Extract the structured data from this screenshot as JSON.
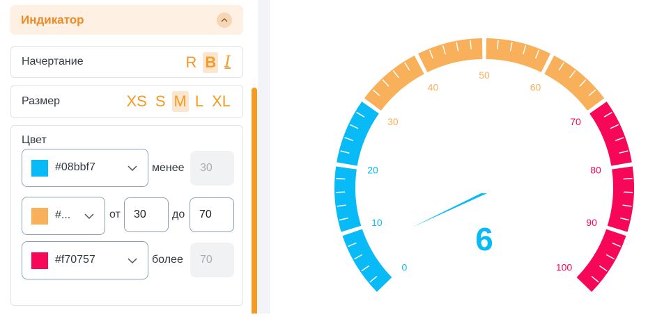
{
  "section": {
    "title": "Индикатор",
    "collapse_icon": "chevron-up-icon"
  },
  "style_card": {
    "label": "Начертание",
    "options": [
      "R",
      "B",
      "I"
    ],
    "selected": "B"
  },
  "size_card": {
    "label": "Размер",
    "options": [
      "XS",
      "S",
      "M",
      "L",
      "XL"
    ],
    "selected": "M"
  },
  "color_card": {
    "label": "Цвет",
    "low": {
      "color": "#08bbf7",
      "value": "#08bbf7",
      "cond_label": "менее",
      "threshold": "30"
    },
    "mid": {
      "color": "#f9b05a",
      "value": "#...",
      "from_label": "от",
      "from": "30",
      "to_label": "до",
      "to": "70"
    },
    "high": {
      "color": "#f70757",
      "value": "#f70757",
      "cond_label": "более",
      "threshold": "70"
    }
  },
  "gauge": {
    "value": 6,
    "value_text": "6",
    "min": 0,
    "max": 100,
    "tick_labels": [
      "0",
      "10",
      "20",
      "30",
      "40",
      "50",
      "60",
      "70",
      "80",
      "90",
      "100"
    ],
    "bands": [
      {
        "from": 0,
        "to": 30,
        "color": "#08bbf7"
      },
      {
        "from": 30,
        "to": 70,
        "color": "#f9b05a"
      },
      {
        "from": 70,
        "to": 100,
        "color": "#f70757"
      }
    ]
  },
  "colors": {
    "accent": "#f59a23",
    "low": "#08bbf7",
    "mid": "#f9b05a",
    "high": "#f70757"
  }
}
